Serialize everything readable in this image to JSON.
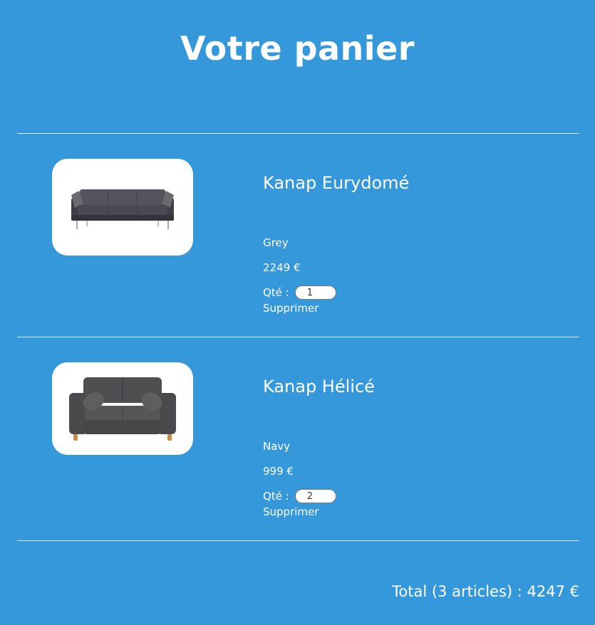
{
  "page": {
    "title": "Votre panier"
  },
  "colors": {
    "background": "#3498db",
    "text": "#ffffff",
    "card": "#ffffff"
  },
  "cart": {
    "items": [
      {
        "name": "Kanap Eurydomé",
        "color": "Grey",
        "price": "2249 €",
        "quantity_label": "Qté :",
        "quantity": "1",
        "delete_label": "Supprimer",
        "image_icon": "three-seat-sofa-icon"
      },
      {
        "name": "Kanap Hélicé",
        "color": "Navy",
        "price": "999 €",
        "quantity_label": "Qté :",
        "quantity": "2",
        "delete_label": "Supprimer",
        "image_icon": "loveseat-sofa-icon"
      }
    ]
  },
  "summary": {
    "total": "Total (3 articles) : 4247 €"
  }
}
